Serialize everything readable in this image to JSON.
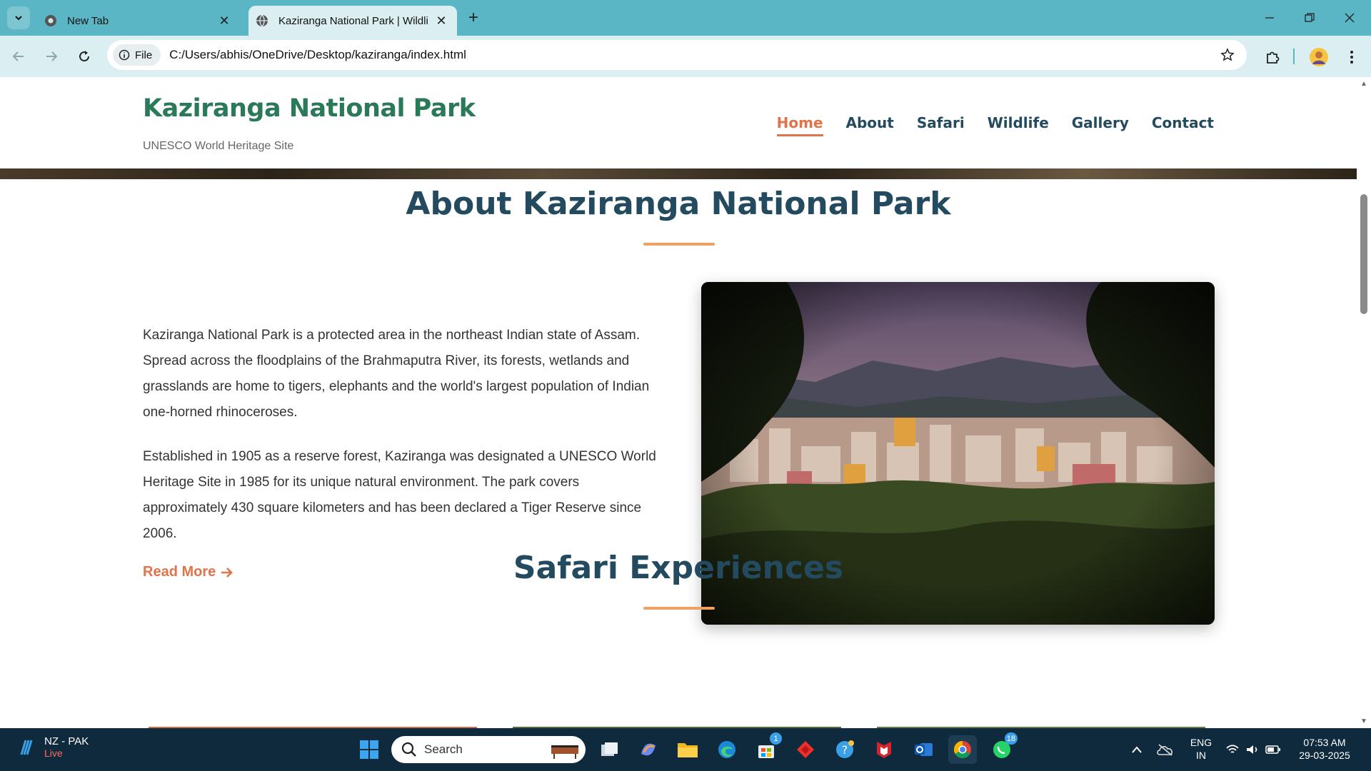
{
  "browser": {
    "tabs": [
      {
        "title": "New Tab",
        "active": false
      },
      {
        "title": "Kaziranga National Park | Wildli",
        "active": true
      }
    ],
    "address": {
      "chip_label": "File",
      "url": "C:/Users/abhis/OneDrive/Desktop/kaziranga/index.html"
    },
    "colors": {
      "frame": "#5ab6c4",
      "toolbar": "#dbeef1"
    }
  },
  "site": {
    "logo_title": "Kaziranga National Park",
    "logo_subtitle": "UNESCO World Heritage Site",
    "nav": [
      "Home",
      "About",
      "Safari",
      "Wildlife",
      "Gallery",
      "Contact"
    ],
    "active_nav": "Home",
    "about": {
      "title": "About Kaziranga National Park",
      "paragraphs": [
        "Kaziranga National Park is a protected area in the northeast Indian state of Assam. Spread across the floodplains of the Brahmaputra River, its forests, wetlands and grasslands are home to tigers, elephants and the world's largest population of Indian one-horned rhinoceroses.",
        "Established in 1905 as a reserve forest, Kaziranga was designated a UNESCO World Heritage Site in 1985 for its unique natural environment. The park covers approximately 430 square kilometers and has been declared a Tiger Reserve since 2006."
      ],
      "read_more": "Read More",
      "image_icon": "city-landscape-photo"
    },
    "safari_title": "Safari Experiences",
    "colors": {
      "heading": "#234a5e",
      "accent": "#e0734a",
      "logo": "#2a7a5a",
      "rule": "#f0a060"
    }
  },
  "taskbar": {
    "news_title": "NZ - PAK",
    "news_status": "Live",
    "search_placeholder": "Search",
    "language": [
      "ENG",
      "IN"
    ],
    "time": "07:53 AM",
    "date": "29-03-2025",
    "badges": {
      "store": "1",
      "whatsapp": "18"
    }
  }
}
